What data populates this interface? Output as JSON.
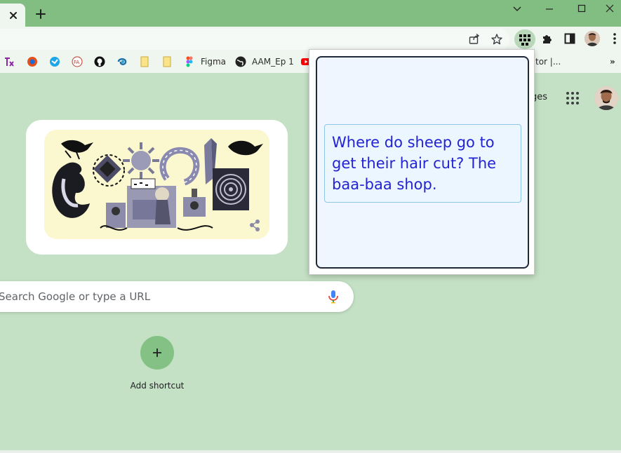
{
  "window": {
    "newtab_symbol": "+"
  },
  "bookmarks": {
    "items": [
      {
        "label": "Figma"
      },
      {
        "label": "AAM_Ep 1"
      },
      {
        "label": "tor |..."
      }
    ],
    "overflow": "»"
  },
  "ntp": {
    "images_link": "ges",
    "search_placeholder": "Search Google or type a URL",
    "shortcut_symbol": "+",
    "shortcut_label": "Add shortcut"
  },
  "popup": {
    "joke": "Where do sheep go to get their hair cut? The baa-baa shop."
  },
  "colors": {
    "titlebar": "#82bd81",
    "toolbar": "#eff6ef",
    "page_bg": "#c4e1c5",
    "joke_text": "#2323d2",
    "popup_bg": "#eff6ff"
  },
  "icons": [
    "close-icon",
    "new-tab-icon",
    "minimize-icon",
    "maximize-icon",
    "window-close-icon",
    "share-icon",
    "star-icon",
    "joke-extension-icon",
    "puzzle-icon",
    "side-panel-icon",
    "profile-avatar",
    "menu-icon",
    "microphone-icon",
    "apps-grid-icon"
  ]
}
